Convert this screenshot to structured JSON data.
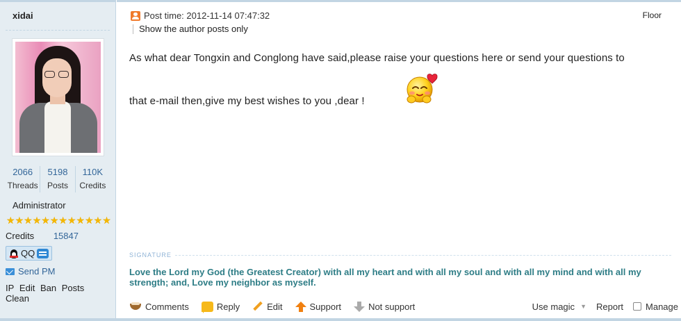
{
  "user": {
    "username": "xidai",
    "stats": [
      {
        "value": "2066",
        "label": "Threads"
      },
      {
        "value": "5198",
        "label": "Posts"
      },
      {
        "value": "110K",
        "label": "Credits"
      }
    ],
    "group": "Administrator",
    "star_count": 12,
    "credits_label": "Credits",
    "credits_value": "15847",
    "qq_label": "QQ",
    "send_pm": "Send PM",
    "admin_tools": [
      "IP",
      "Edit",
      "Ban",
      "Posts",
      "Clean"
    ]
  },
  "post": {
    "post_time": "Post time: 2012-11-14 07:47:32",
    "author_only": "Show the author posts only",
    "floor": "Floor",
    "content_line1": "As what dear Tongxin and Conglong have said,please raise your questions here or send your questions to",
    "content_line2": "that e-mail then,give my best wishes to you ,dear !",
    "emoji_icon": "blushing-smiley-with-heart"
  },
  "signature": {
    "label": "SIGNATURE",
    "text": "Love the Lord my God (the Greatest Creator) with all my heart and with all my soul and with all my mind and with all my strength; and, Love my neighbor as myself."
  },
  "actions": {
    "comments": "Comments",
    "reply": "Reply",
    "edit": "Edit",
    "support": "Support",
    "not_support": "Not support",
    "use_magic": "Use magic",
    "report": "Report",
    "manage": "Manage"
  },
  "colors": {
    "sidebar_bg": "#e5edf2",
    "border": "#c2d5e3",
    "link_blue": "#336699",
    "signature_teal": "#2e7d86",
    "star_gold": "#f5b800"
  }
}
